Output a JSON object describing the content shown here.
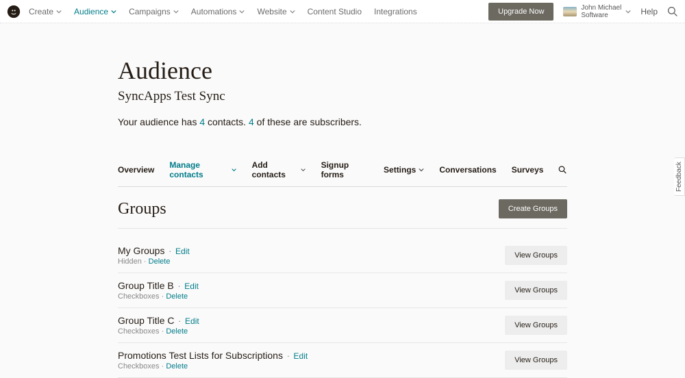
{
  "colors": {
    "accent": "#007c89",
    "text": "#241c15",
    "muted": "#6a6a6a",
    "btn_dark": "#6c6960",
    "btn_light": "#ededed"
  },
  "topnav": {
    "items": [
      {
        "label": "Create",
        "dropdown": true,
        "active": false
      },
      {
        "label": "Audience",
        "dropdown": true,
        "active": true
      },
      {
        "label": "Campaigns",
        "dropdown": true,
        "active": false
      },
      {
        "label": "Automations",
        "dropdown": true,
        "active": false
      },
      {
        "label": "Website",
        "dropdown": true,
        "active": false
      },
      {
        "label": "Content Studio",
        "dropdown": false,
        "active": false
      },
      {
        "label": "Integrations",
        "dropdown": false,
        "active": false
      }
    ],
    "upgrade": "Upgrade Now",
    "account_line1": "John Michael",
    "account_line2": "Software",
    "help": "Help"
  },
  "page": {
    "title": "Audience",
    "subtitle": "SyncApps Test Sync",
    "stats_prefix": "Your audience has ",
    "stats_count1": "4",
    "stats_mid": " contacts. ",
    "stats_count2": "4",
    "stats_suffix": " of these are subscribers."
  },
  "subnav": [
    {
      "label": "Overview",
      "dropdown": false,
      "active": false
    },
    {
      "label": "Manage contacts",
      "dropdown": true,
      "active": true
    },
    {
      "label": "Add contacts",
      "dropdown": true,
      "active": false
    },
    {
      "label": "Signup forms",
      "dropdown": false,
      "active": false
    },
    {
      "label": "Settings",
      "dropdown": true,
      "active": false
    },
    {
      "label": "Conversations",
      "dropdown": false,
      "active": false
    },
    {
      "label": "Surveys",
      "dropdown": false,
      "active": false
    }
  ],
  "section": {
    "title": "Groups",
    "create_btn": "Create Groups",
    "view_btn": "View Groups",
    "edit": "Edit",
    "delete": "Delete",
    "sep": " · "
  },
  "groups": [
    {
      "title": "My Groups",
      "type": "Hidden"
    },
    {
      "title": "Group Title B",
      "type": "Checkboxes"
    },
    {
      "title": "Group Title C",
      "type": "Checkboxes"
    },
    {
      "title": "Promotions Test Lists for Subscriptions",
      "type": "Checkboxes"
    }
  ],
  "feedback": "Feedback"
}
